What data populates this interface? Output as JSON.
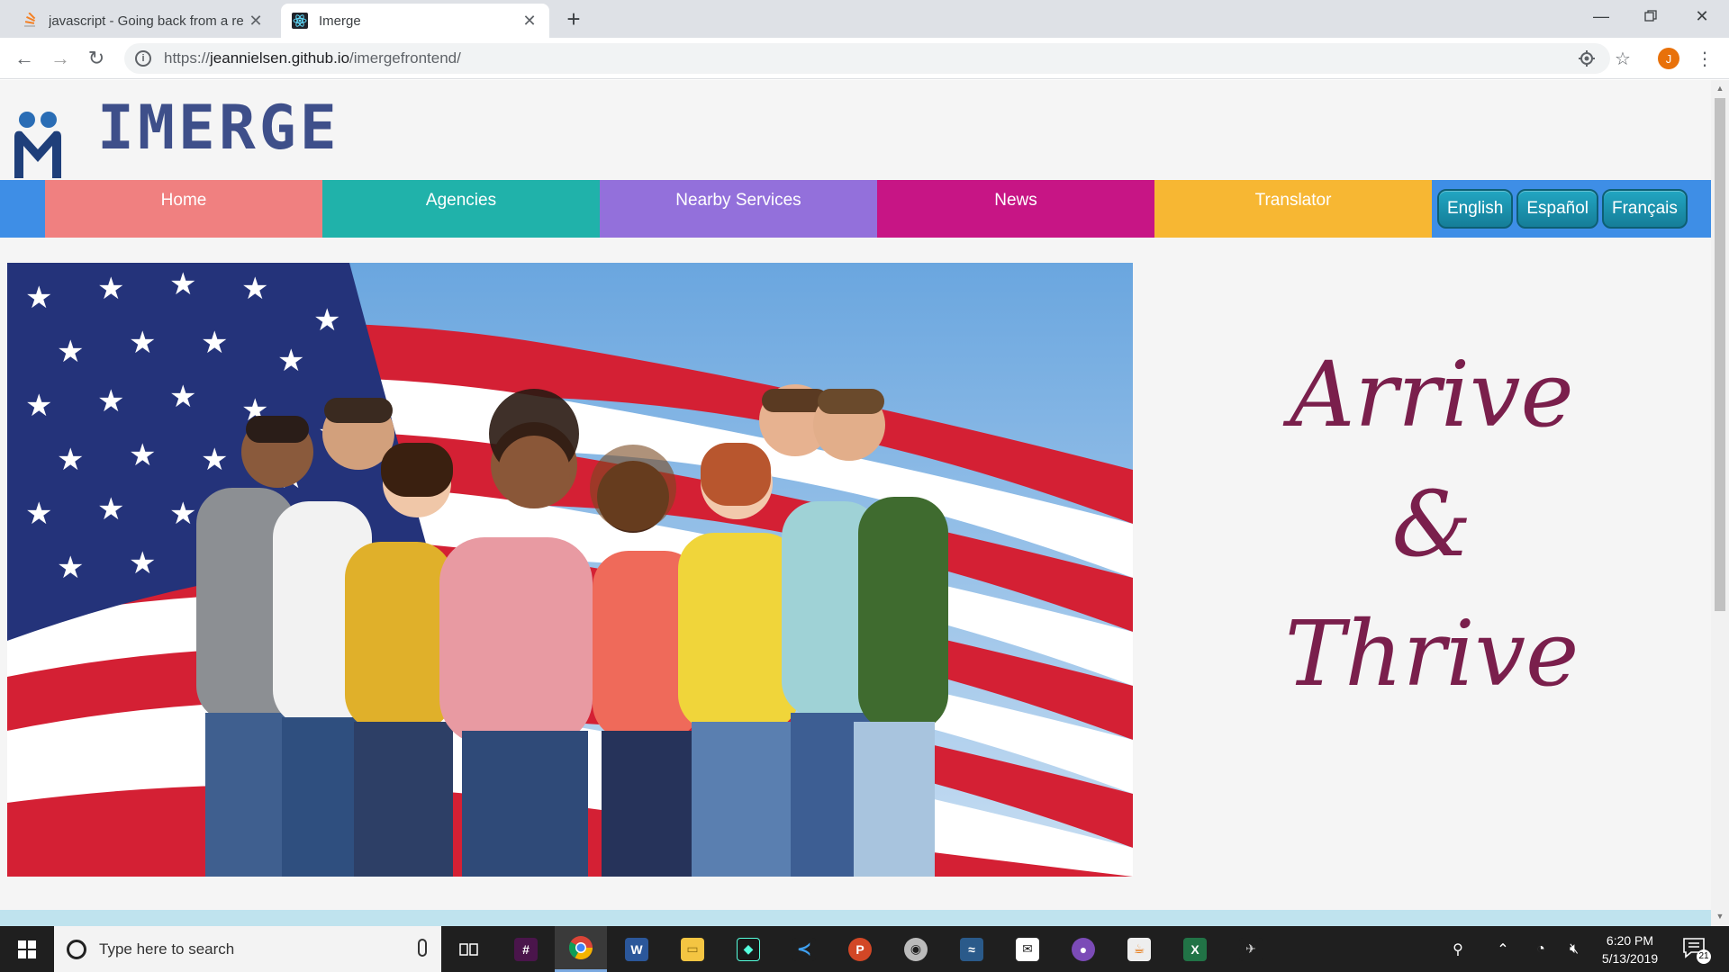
{
  "browser": {
    "tabs": [
      {
        "title": "javascript - Going back from a re",
        "favicon": "stackoverflow-icon",
        "active": false
      },
      {
        "title": "Imerge",
        "favicon": "react-icon",
        "active": true
      }
    ],
    "url_prefix": "https://",
    "url_host": "jeannielsen.github.io",
    "url_path": "/imergefrontend/",
    "profile_initial": "J"
  },
  "site": {
    "logo_text": "IMERGE",
    "nav": [
      {
        "label": "Home",
        "color": "#f08080"
      },
      {
        "label": "Agencies",
        "color": "#20b2aa"
      },
      {
        "label": "Nearby Services",
        "color": "#9370db"
      },
      {
        "label": "News",
        "color": "#c71585"
      },
      {
        "label": "Translator",
        "color": "#f7b733"
      }
    ],
    "languages": [
      "English",
      "Español",
      "Français"
    ],
    "tagline": {
      "line1": "Arrive",
      "amp": "&",
      "line2": "Thrive"
    },
    "tagline_color": "#7a1f4c"
  },
  "taskbar": {
    "search_placeholder": "Type here to search",
    "time": "6:20 PM",
    "date": "5/13/2019",
    "notification_count": "21",
    "pinned": [
      "task-view",
      "slack",
      "chrome",
      "word",
      "file-explorer",
      "gitkraken",
      "vscode",
      "powerpoint",
      "github-desktop",
      "mysql-workbench",
      "mail",
      "github",
      "java",
      "excel",
      "misc-app"
    ]
  }
}
